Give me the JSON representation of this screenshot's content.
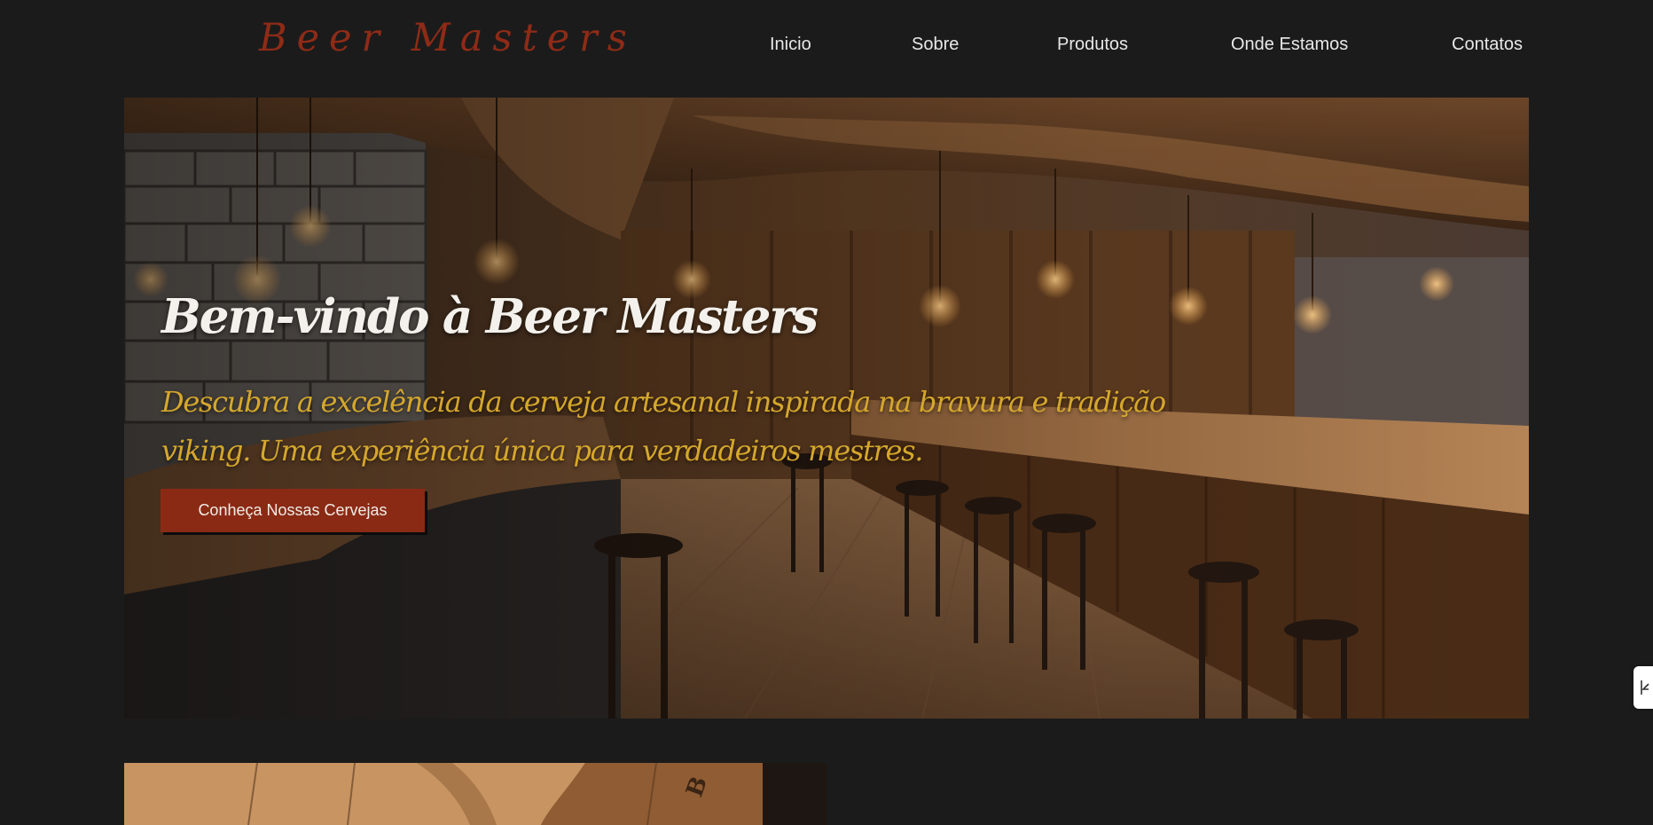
{
  "brand": {
    "logo_text": "Beer Masters"
  },
  "nav": {
    "items": [
      {
        "label": "Inicio"
      },
      {
        "label": "Sobre"
      },
      {
        "label": "Produtos"
      },
      {
        "label": "Onde Estamos"
      },
      {
        "label": "Contatos"
      }
    ]
  },
  "hero": {
    "title": "Bem-vindo à Beer Masters",
    "subtitle": "Descubra a excelência da cerveja artesanal inspirada na bravura e tradição viking. Uma experiência única para verdadeiros mestres.",
    "cta_label": "Conheça Nossas Cervejas"
  },
  "icons": {
    "side_widget": "arrow-collapse-icon"
  },
  "colors": {
    "background": "#1b1b1b",
    "brand": "#8e2b17",
    "nav_text": "#e8e8e8",
    "hero_title": "#f4f1ec",
    "hero_subtitle": "#d5a72c",
    "button": "#8a2a15"
  }
}
